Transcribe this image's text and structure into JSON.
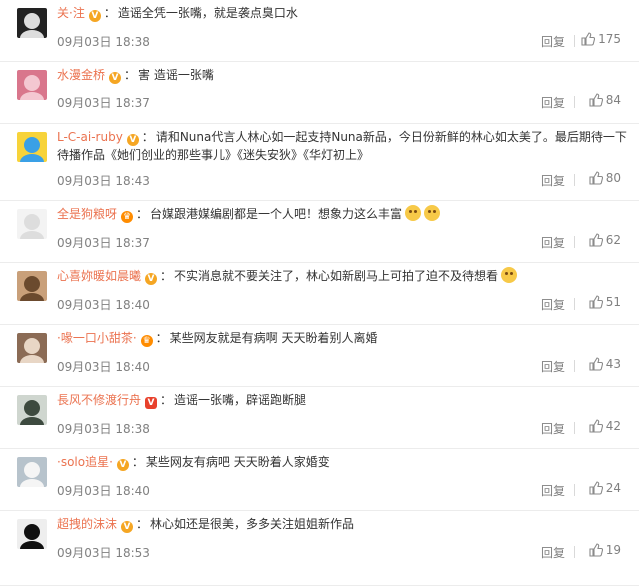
{
  "colors": {
    "username": "#eb7350",
    "text": "#333333",
    "meta": "#808080"
  },
  "comments": [
    {
      "username": "关·注",
      "badge": "v",
      "text": "造谣全凭一张嘴，就是袭点臭口水",
      "emoji_count": 0,
      "time": "09月03日 18:38",
      "reply": "回复",
      "likes": "175",
      "avatar": "avatar-icon-dark"
    },
    {
      "username": "水漫金桥",
      "badge": "v",
      "text": "害 造谣一张嘴",
      "emoji_count": 0,
      "time": "09月03日 18:37",
      "reply": "回复",
      "likes": "84",
      "avatar": "avatar-icon-pink"
    },
    {
      "username": "L-C-ai-ruby",
      "badge": "v",
      "text": "请和Nuna代言人林心如一起支持Nuna新品，今日份新鲜的林心如太美了。最后期待一下待播作品《她们创业的那些事儿》《迷失安狄》《华灯初上》",
      "emoji_count": 0,
      "time": "09月03日 18:43",
      "reply": "回复",
      "likes": "80",
      "avatar": "avatar-icon-pikachu"
    },
    {
      "username": "全是狗粮呀",
      "badge": "crown",
      "text": "台媒跟港媒编剧都是一个人吧！想象力这么丰富",
      "emoji_count": 2,
      "time": "09月03日 18:37",
      "reply": "回复",
      "likes": "62",
      "avatar": "avatar-icon-white"
    },
    {
      "username": "心喜妳暖如晨曦",
      "badge": "v",
      "text": "不实消息就不要关注了，林心如新剧马上可拍了迫不及待想看",
      "emoji_count": 1,
      "time": "09月03日 18:40",
      "reply": "回复",
      "likes": "51",
      "avatar": "avatar-icon-girl"
    },
    {
      "username": "·喙一口小甜茶·",
      "badge": "crown",
      "text": "某些网友就是有病啊 天天盼着别人离婚",
      "emoji_count": 0,
      "time": "09月03日 18:40",
      "reply": "回复",
      "likes": "43",
      "avatar": "avatar-icon-portrait"
    },
    {
      "username": "長风不修渡行舟",
      "badge": "vred",
      "text": "造谣一张嘴，辟谣跑断腿",
      "emoji_count": 0,
      "time": "09月03日 18:38",
      "reply": "回复",
      "likes": "42",
      "avatar": "avatar-icon-figure"
    },
    {
      "username": "·solo追星·",
      "badge": "v",
      "text": "某些网友有病吧 天天盼着人家婚变",
      "emoji_count": 0,
      "time": "09月03日 18:40",
      "reply": "回复",
      "likes": "24",
      "avatar": "avatar-icon-cat"
    },
    {
      "username": "超拽的沫沫",
      "badge": "v",
      "text": "林心如还是很美，多多关注姐姐新作品",
      "emoji_count": 0,
      "time": "09月03日 18:53",
      "reply": "回复",
      "likes": "19",
      "avatar": "avatar-icon-mono"
    }
  ]
}
